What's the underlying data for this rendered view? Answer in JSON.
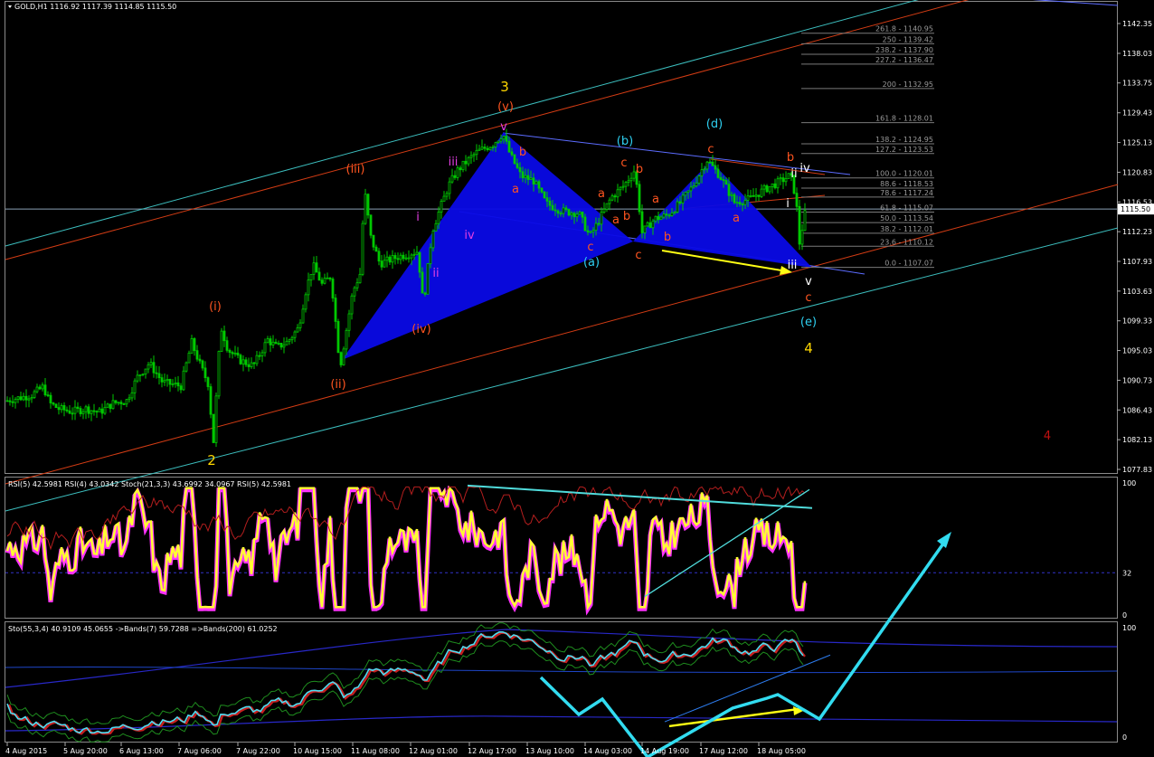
{
  "header": {
    "main": "GOLD,H1  1116.92 1117.39 1114.85 1115.50",
    "rsi": "RSI(5) 42.5981  RSI(4) 43.0342  Stoch(21,3,3) 43.6992 34.0967  RSI(5) 42.5981",
    "sto": "Sto(55,3,4) 40.9109 45.0655  ->Bands(7) 59.7288  =>Bands(200) 61.0252"
  },
  "chart_data": [
    {
      "type": "line",
      "symbol": "GOLD",
      "timeframe": "H1",
      "ohlc_current": {
        "open": 1116.92,
        "high": 1117.39,
        "low": 1114.85,
        "close": 1115.5
      },
      "current_price_label": "1115.50",
      "y_ticks": [
        "1142.35",
        "1138.03",
        "1133.75",
        "1129.43",
        "1125.13",
        "1120.83",
        "1116.53",
        "1112.23",
        "1107.93",
        "1103.63",
        "1099.33",
        "1095.03",
        "1090.73",
        "1086.43",
        "1082.13",
        "1077.83"
      ],
      "x_ticks": [
        "4 Aug 2015",
        "5 Aug 20:00",
        "6 Aug 13:00",
        "7 Aug 06:00",
        "7 Aug 22:00",
        "10 Aug 15:00",
        "11 Aug 08:00",
        "12 Aug 01:00",
        "12 Aug 17:00",
        "13 Aug 10:00",
        "14 Aug 03:00",
        "14 Aug 19:00",
        "17 Aug 12:00",
        "18 Aug 05:00"
      ],
      "price_path": [
        [
          0,
          1087.3
        ],
        [
          10,
          1087.9
        ],
        [
          22,
          1088.2
        ],
        [
          35,
          1088.6
        ],
        [
          48,
          1089.8
        ],
        [
          55,
          1087.4
        ],
        [
          65,
          1086.6
        ],
        [
          80,
          1086.2
        ],
        [
          95,
          1086.6
        ],
        [
          110,
          1086.1
        ],
        [
          125,
          1087.4
        ],
        [
          140,
          1087.8
        ],
        [
          152,
          1091.2
        ],
        [
          165,
          1093.2
        ],
        [
          180,
          1090.4
        ],
        [
          200,
          1089.9
        ],
        [
          212,
          1096.2
        ],
        [
          222,
          1092.7
        ],
        [
          230,
          1090.3
        ],
        [
          236,
          1081.9
        ],
        [
          244,
          1098.6
        ],
        [
          252,
          1095.2
        ],
        [
          264,
          1093.7
        ],
        [
          280,
          1092.8
        ],
        [
          296,
          1096.6
        ],
        [
          306,
          1095.5
        ],
        [
          318,
          1096.3
        ],
        [
          330,
          1098.3
        ],
        [
          338,
          1103.6
        ],
        [
          346,
          1107.4
        ],
        [
          356,
          1104.6
        ],
        [
          366,
          1105.8
        ],
        [
          376,
          1092.6
        ],
        [
          390,
          1103.5
        ],
        [
          398,
          1106.1
        ],
        [
          403,
          1118.3
        ],
        [
          410,
          1111.4
        ],
        [
          420,
          1107.6
        ],
        [
          440,
          1108.6
        ],
        [
          462,
          1109.4
        ],
        [
          468,
          1101.6
        ],
        [
          478,
          1112.4
        ],
        [
          488,
          1116.1
        ],
        [
          496,
          1118.9
        ],
        [
          506,
          1121.1
        ],
        [
          516,
          1122.4
        ],
        [
          528,
          1123.8
        ],
        [
          545,
          1124.9
        ],
        [
          556,
          1126.4
        ],
        [
          564,
          1123.4
        ],
        [
          576,
          1120.3
        ],
        [
          590,
          1119.6
        ],
        [
          604,
          1116.3
        ],
        [
          622,
          1115.2
        ],
        [
          640,
          1114.9
        ],
        [
          652,
          1111.5
        ],
        [
          662,
          1113.8
        ],
        [
          676,
          1117.2
        ],
        [
          690,
          1118.9
        ],
        [
          702,
          1121.2
        ],
        [
          710,
          1112.1
        ],
        [
          724,
          1114.1
        ],
        [
          738,
          1114.6
        ],
        [
          752,
          1116.4
        ],
        [
          766,
          1118.8
        ],
        [
          782,
          1122.6
        ],
        [
          796,
          1120.3
        ],
        [
          812,
          1116.5
        ],
        [
          828,
          1116.9
        ],
        [
          846,
          1118.4
        ],
        [
          860,
          1119.3
        ],
        [
          874,
          1120.4
        ],
        [
          880,
          1117.2
        ],
        [
          884,
          1110.6
        ],
        [
          891,
          1115.5
        ]
      ]
    },
    {
      "type": "line",
      "name": "RSI / Stochastic panel",
      "y_ticks": [
        "100",
        "32",
        "0"
      ],
      "series": [
        {
          "name": "RSI(5)",
          "value": 42.5981
        },
        {
          "name": "RSI(4)",
          "value": 43.0342
        },
        {
          "name": "Stoch(21,3,3)",
          "values": [
            43.6992,
            34.0967
          ]
        }
      ]
    },
    {
      "type": "line",
      "name": "Sto(55,3,4) panel",
      "y_ticks": [
        "100",
        "0"
      ],
      "series": [
        {
          "name": "Sto(55,3,4)",
          "values": [
            40.9109,
            45.0655
          ]
        },
        {
          "name": "Bands(7)",
          "value": 59.7288
        },
        {
          "name": "Bands(200)",
          "value": 61.0252
        }
      ]
    }
  ],
  "fib_levels": [
    {
      "pct": "261.8",
      "value": "1140.95"
    },
    {
      "pct": "250",
      "value": "1139.42"
    },
    {
      "pct": "238.2",
      "value": "1137.90"
    },
    {
      "pct": "227.2",
      "value": "1136.47"
    },
    {
      "pct": "200",
      "value": "1132.95"
    },
    {
      "pct": "161.8",
      "value": "1128.01"
    },
    {
      "pct": "138.2",
      "value": "1124.95"
    },
    {
      "pct": "127.2",
      "value": "1123.53"
    },
    {
      "pct": "100.0",
      "value": "1120.01"
    },
    {
      "pct": "88.6",
      "value": "1118.53"
    },
    {
      "pct": "78.6",
      "value": "1117.24"
    },
    {
      "pct": "61.8",
      "value": "1115.07"
    },
    {
      "pct": "50.0",
      "value": "1113.54"
    },
    {
      "pct": "38.2",
      "value": "1112.01"
    },
    {
      "pct": "23.6",
      "value": "1110.12"
    },
    {
      "pct": "0.0",
      "value": "1107.07"
    }
  ],
  "wave_labels": [
    {
      "text": "3",
      "color": "#ffd700",
      "big": true
    },
    {
      "text": "(v)",
      "color": "#ff5520"
    },
    {
      "text": "v",
      "color": "#e23ee2"
    },
    {
      "text": "(iii)",
      "color": "#ff5520"
    },
    {
      "text": "iii",
      "color": "#e23ee2"
    },
    {
      "text": "i",
      "color": "#e23ee2"
    },
    {
      "text": "iv",
      "color": "#e23ee2"
    },
    {
      "text": "ii",
      "color": "#e23ee2"
    },
    {
      "text": "(iv)",
      "color": "#ff5520"
    },
    {
      "text": "(ii)",
      "color": "#ff5520"
    },
    {
      "text": "(i)",
      "color": "#ff5520"
    },
    {
      "text": "2",
      "color": "#ffd700",
      "big": true
    },
    {
      "text": "b",
      "color": "#ff5520"
    },
    {
      "text": "a",
      "color": "#ff5520"
    },
    {
      "text": "c",
      "color": "#ff5520"
    },
    {
      "text": "(a)",
      "color": "#2ecff0"
    },
    {
      "text": "(b)",
      "color": "#2ecff0"
    },
    {
      "text": "c",
      "color": "#ff5520"
    },
    {
      "text": "b",
      "color": "#ff5520"
    },
    {
      "text": "a",
      "color": "#ff5520"
    },
    {
      "text": "b",
      "color": "#ff5520"
    },
    {
      "text": "a",
      "color": "#ff5520"
    },
    {
      "text": "c",
      "color": "#ff5520"
    },
    {
      "text": "a",
      "color": "#ff5520"
    },
    {
      "text": "b",
      "color": "#ff5520"
    },
    {
      "text": "(d)",
      "color": "#2ecff0"
    },
    {
      "text": "c",
      "color": "#ff5520"
    },
    {
      "text": "a",
      "color": "#ff5520"
    },
    {
      "text": "b",
      "color": "#ff5520"
    },
    {
      "text": "ii",
      "color": "#ffffff"
    },
    {
      "text": "iv",
      "color": "#ffffff"
    },
    {
      "text": "i",
      "color": "#ffffff"
    },
    {
      "text": "iii",
      "color": "#ffffff"
    },
    {
      "text": "v",
      "color": "#ffffff"
    },
    {
      "text": "c",
      "color": "#ff5520"
    },
    {
      "text": "(e)",
      "color": "#2ecff0"
    },
    {
      "text": "4",
      "color": "#ffd700",
      "big": true
    },
    {
      "text": "4",
      "color": "#c01010"
    }
  ],
  "colors": {
    "background": "#000000",
    "candle": "#00c800",
    "triangle_fill": "#0a0ae6",
    "channel_red": "#d23c14",
    "channel_teal": "#3cbebe",
    "wave_orange": "#ff5520",
    "wave_cyan": "#2ecff0",
    "wave_magenta": "#e23ee2",
    "wave_yellow": "#ffd700",
    "rsi_line": "#ffff32",
    "rsi_glow": "#ff32ff",
    "arrow_cyan": "#32dcf0",
    "arrow_yellow": "#ffff14"
  }
}
